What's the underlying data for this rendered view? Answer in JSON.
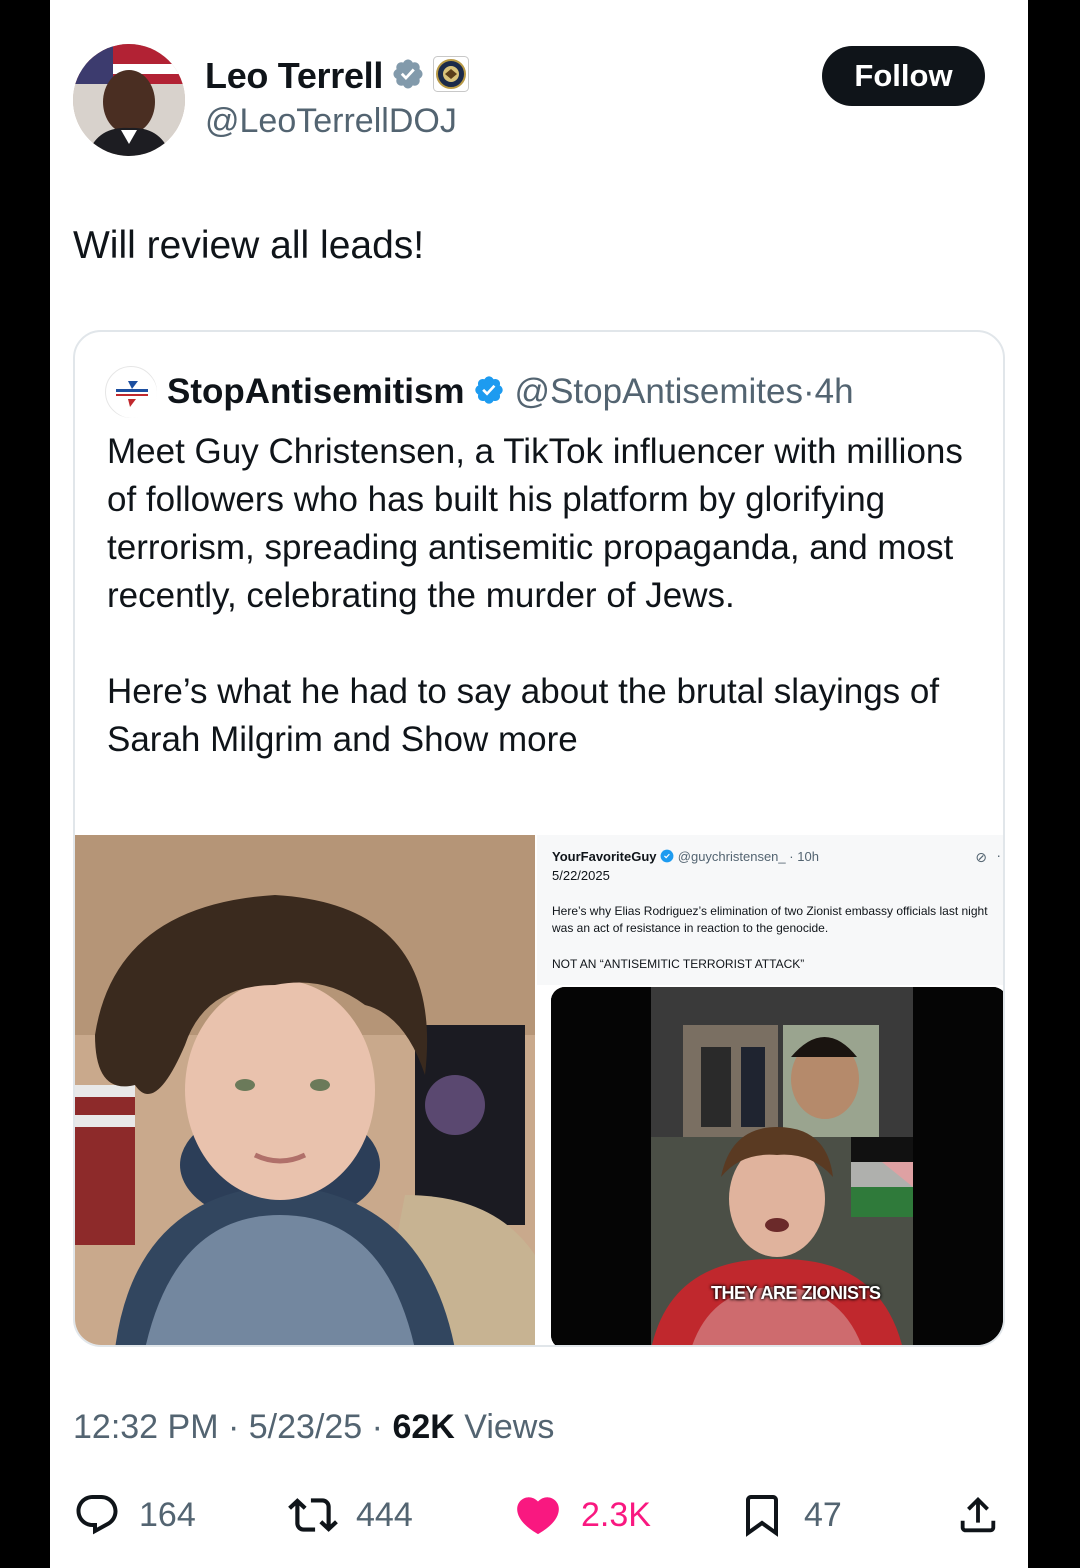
{
  "author": {
    "display_name": "Leo Terrell",
    "handle": "@LeoTerrellDOJ",
    "avatar_icon": "profile-photo"
  },
  "follow_label": "Follow",
  "tweet_text": "Will review all leads!",
  "quote": {
    "display_name": "StopAntisemitism",
    "handle": "@StopAntisemites",
    "time": "4h",
    "paragraph1": "Meet Guy Christensen, a TikTok influencer with millions of followers who has built his platform by glorifying terrorism, spreading antisemitic propaganda, and most recently, celebrating the murder of Jews.",
    "paragraph2": "Here’s what he had to say about the brutal slayings of Sarah Milgrim and ",
    "show_more": "Show more",
    "media": {
      "inner_tweet": {
        "display_name": "YourFavoriteGuy",
        "handle": "@guychristensen_",
        "time": "10h",
        "date": "5/22/2025",
        "text": "Here’s why Elias Rodriguez’s elimination of two Zionist embassy officials last night was an act of resistance in reaction to the genocide.",
        "caps_text": "NOT AN “ANTISEMITIC TERRORIST ATTACK”"
      },
      "video_caption": "THEY ARE ZIONISTS"
    }
  },
  "meta": {
    "time": "12:32 PM",
    "date": "5/23/25",
    "views_count": "62K",
    "views_label": "Views"
  },
  "actions": {
    "replies": "164",
    "reposts": "444",
    "likes": "2.3K",
    "bookmarks": "47"
  },
  "colors": {
    "accent": "#1d9bf0",
    "like": "#f91880",
    "text": "#0f1419",
    "secondary": "#536471"
  }
}
